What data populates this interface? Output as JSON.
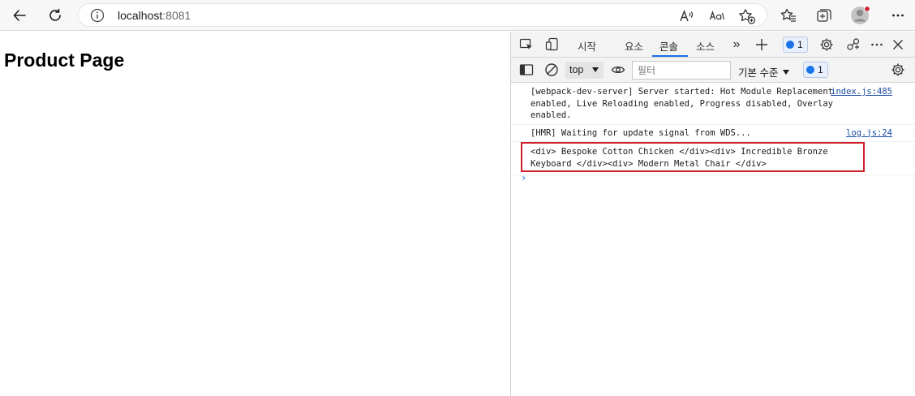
{
  "browser": {
    "address": {
      "host": "localhost",
      "port": ":8081"
    }
  },
  "page": {
    "heading": "Product Page"
  },
  "devtools": {
    "tabs": [
      {
        "label": "시작"
      },
      {
        "label": "요소"
      },
      {
        "label": "콘솔"
      },
      {
        "label": "소스"
      }
    ],
    "issues_count": "1",
    "filterbar": {
      "context": "top",
      "filter_placeholder": "필터",
      "levels": "기본 수준",
      "issues_count": "1"
    },
    "console": {
      "messages": [
        {
          "text": "[webpack-dev-server] Server started: Hot Module Replacement enabled, Live Reloading enabled, Progress disabled, Overlay enabled.",
          "source": "index.js:485"
        },
        {
          "text": "[HMR] Waiting for update signal from WDS...",
          "source": "log.js:24"
        },
        {
          "text": "<div> Bespoke Cotton Chicken </div><div> Incredible Bronze Keyboard </div><div> Modern Metal Chair </div>",
          "source": ""
        }
      ],
      "prompt": "›"
    }
  },
  "colors": {
    "accent": "#1a73e8",
    "highlight_border": "#d0202c",
    "link": "#1a4ba5"
  }
}
